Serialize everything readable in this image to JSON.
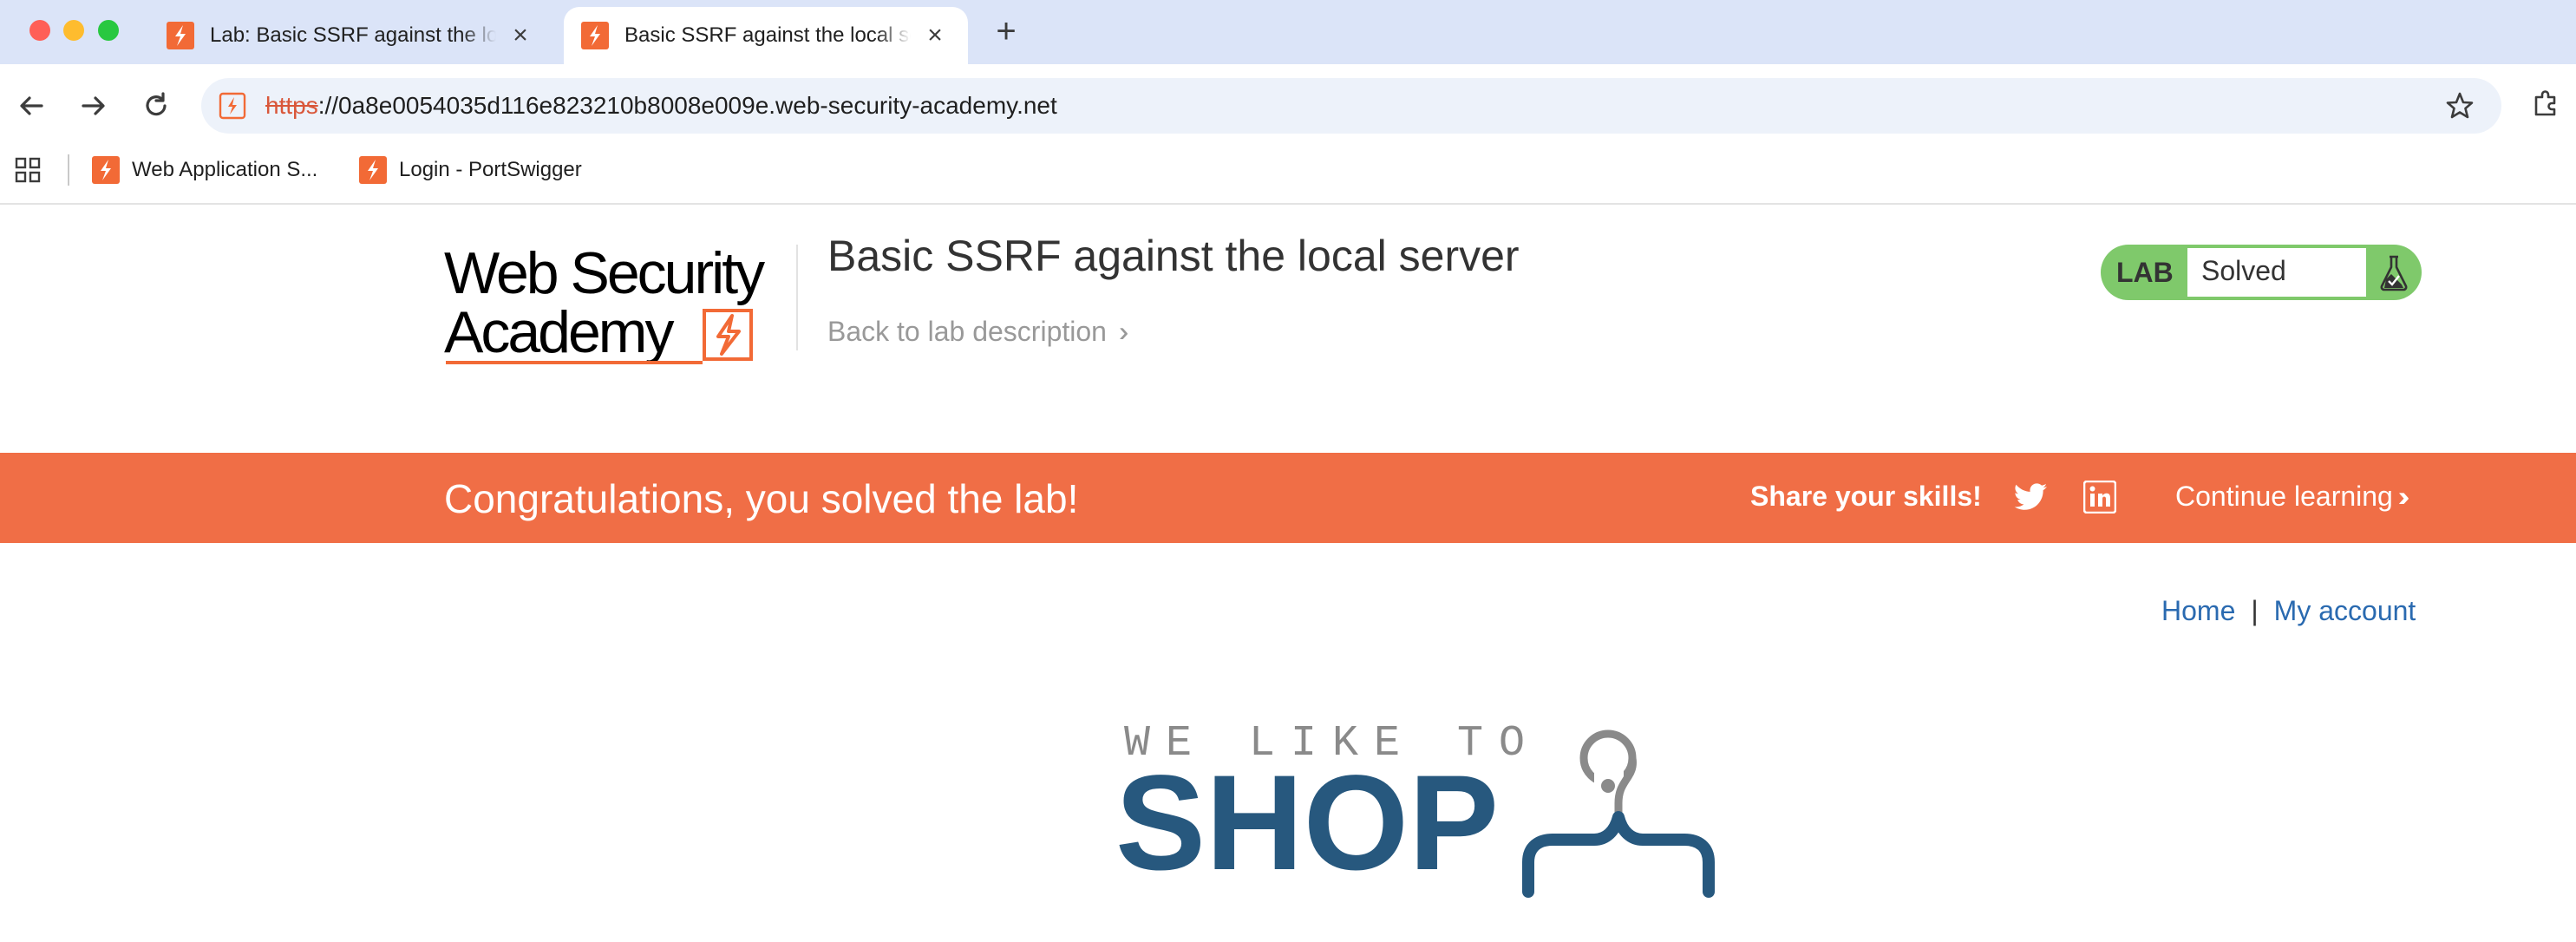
{
  "browser": {
    "tabs": [
      {
        "title": "Lab: Basic SSRF against the local server",
        "active": false
      },
      {
        "title": "Basic SSRF against the local server",
        "active": true
      }
    ],
    "url_scheme": "https",
    "url_rest": "://0a8e0054035d116e823210b8008e009e.web-security-academy.net",
    "bookmarks": [
      {
        "label": "Web Application S..."
      },
      {
        "label": "Login - PortSwigger"
      }
    ]
  },
  "lab_header": {
    "logo_line1": "Web Security",
    "logo_line2": "Academy",
    "title": "Basic SSRF against the local server",
    "back_link": "Back to lab description",
    "status_label": "LAB",
    "status_value": "Solved"
  },
  "banner": {
    "message": "Congratulations, you solved the lab!",
    "share": "Share your skills!",
    "continue": "Continue learning"
  },
  "shop_nav": {
    "home": "Home",
    "separator": "|",
    "account": "My account"
  },
  "shop_logo": {
    "tagline": "WE LIKE TO",
    "word": "SHOP"
  },
  "colors": {
    "banner": "#f06e46",
    "lab_solved": "#7fc96b",
    "link": "#2a6ab0",
    "shop_blue": "#27587e",
    "portswigger_orange": "#f26a36"
  },
  "icons": [
    "traffic-light-icons",
    "portswigger-favicon",
    "close-icon",
    "plus-icon",
    "back-arrow-icon",
    "forward-arrow-icon",
    "reload-icon",
    "star-icon",
    "extensions-icon",
    "apps-grid-icon",
    "flask-icon",
    "twitter-icon",
    "linkedin-icon",
    "chevron-double-right-icon",
    "hanger-icon"
  ]
}
